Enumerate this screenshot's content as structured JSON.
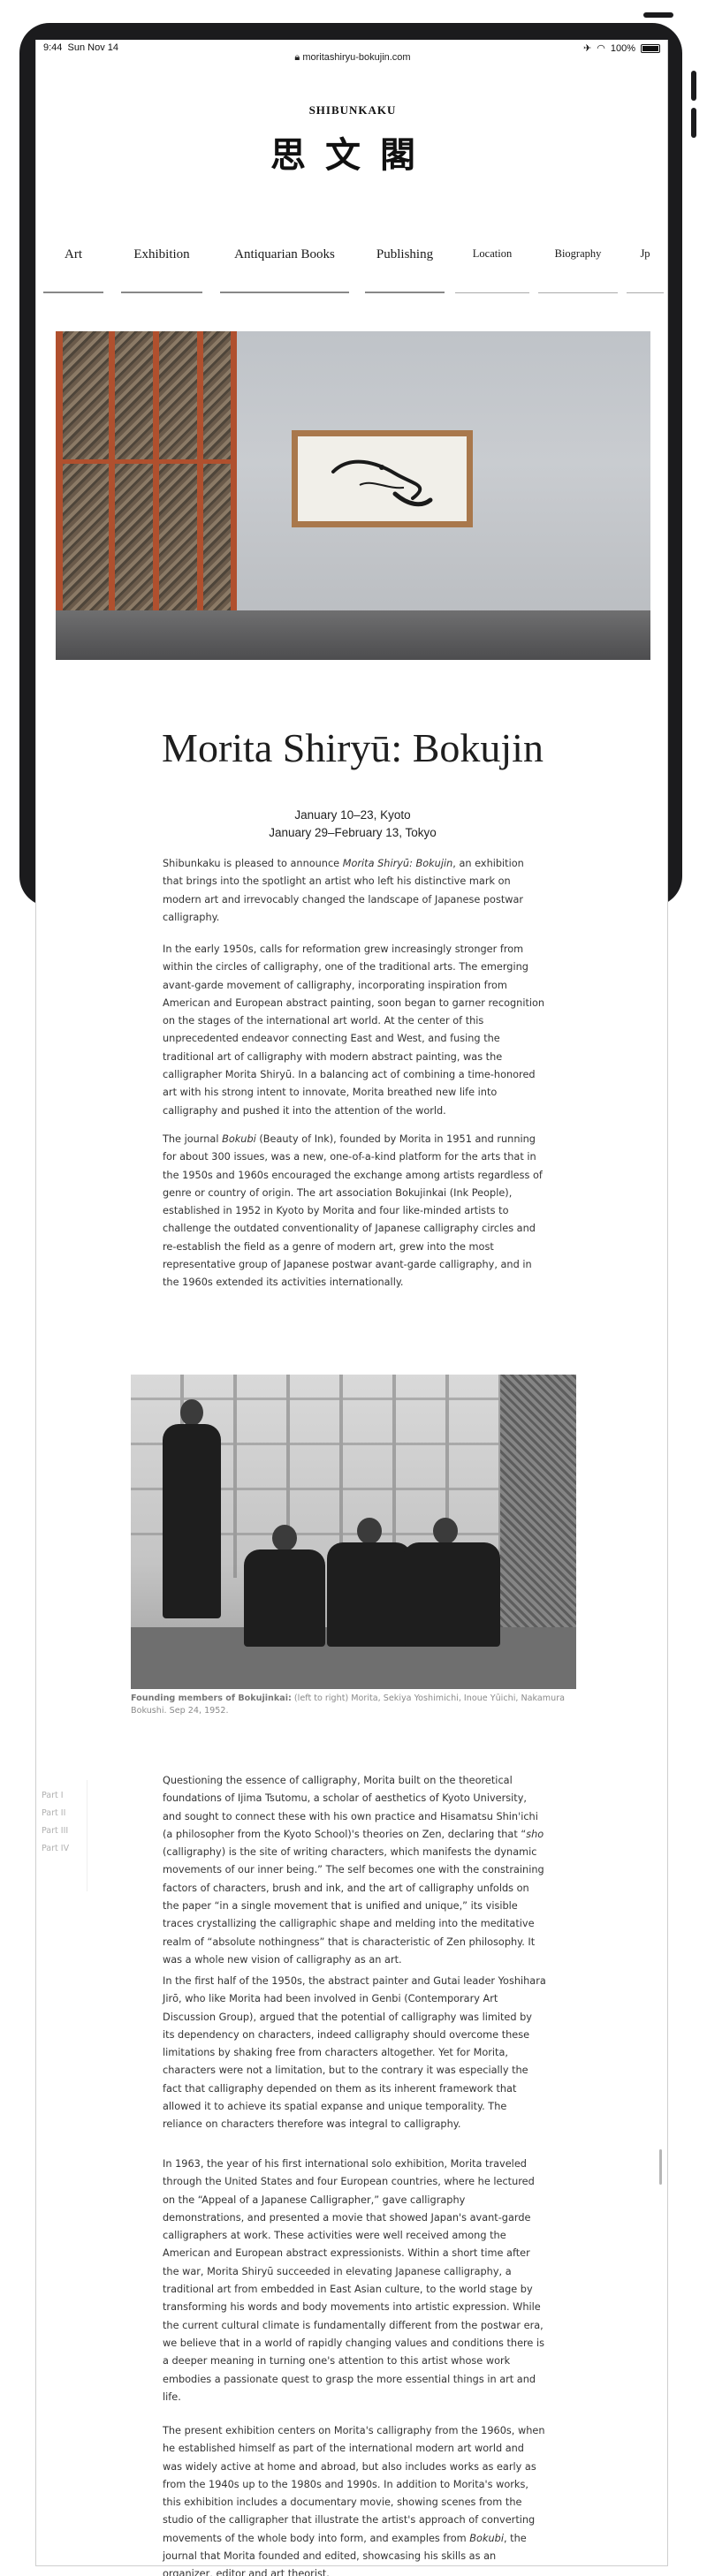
{
  "status_bar": {
    "time": "9:44",
    "date": "Sun Nov 14",
    "battery": "100%"
  },
  "url": "moritashiryu-bokujin.com",
  "brand": {
    "name": "SHIBUNKAKU",
    "logo_text": "思文閣"
  },
  "nav": [
    "Art",
    "Exhibition",
    "Antiquarian Books",
    "Publishing",
    "Location",
    "Biography",
    "Jp"
  ],
  "exhibition": {
    "title": "Morita Shiryū: Bokujin",
    "dates": [
      "January 10–23, Kyoto",
      "January 29–February 13, Tokyo"
    ]
  },
  "paragraphs": {
    "p1": [
      "Shibunkaku is pleased to announce ",
      "Morita Shiryū: Bokujin",
      ", an exhibition that brings into the spotlight an artist who left his distinctive mark on modern art and irrevocably changed the landscape of Japanese postwar calligraphy."
    ],
    "p2": "In the early 1950s, calls for reformation grew increasingly stronger from within the circles of calligraphy, one of the traditional arts. The emerging avant-garde movement of calligraphy, incorporating inspiration from American and European abstract painting, soon began to garner recognition on the stages of the international art world. At the center of this unprecedented endeavor connecting East and West, and fusing the traditional art of calligraphy with modern abstract painting, was the calligrapher Morita Shiryū. In a balancing act of combining a time-honored art with his strong intent to innovate, Morita breathed new life into calligraphy and pushed it into the attention of the world.",
    "p3": [
      "The journal ",
      "Bokubi",
      " (Beauty of Ink), founded by Morita in 1951 and running for about 300 issues, was a new, one-of-a-kind platform for the arts that in the 1950s and 1960s encouraged the exchange among artists regardless of genre or country of origin. The art association Bokujinkai (Ink People), established in 1952 in Kyoto by Morita and four like-minded artists to challenge the outdated conventionality of Japanese calligraphy circles and re-establish the field as a genre of modern art, grew into the most representative group of Japanese postwar avant-garde calligraphy, and in the 1960s extended its activities internationally."
    ],
    "p4": [
      "Questioning the essence of calligraphy, Morita built on the theoretical foundations of Ijima Tsutomu, a scholar of aesthetics of Kyoto University, and sought to connect these with his own practice and Hisamatsu Shin'ichi (a philosopher from the Kyoto School)'s theories on Zen, declaring that “",
      "sho",
      " (calligraphy) is the site of writing characters, which manifests the dynamic movements of our inner being.” The self becomes one with the constraining factors of characters, brush and ink, and the art of calligraphy unfolds on the paper “in a single movement that is unified and unique,” its visible traces crystallizing the calligraphic shape and melding into the meditative realm of “absolute nothingness” that is characteristic of Zen philosophy. It was a whole new vision of calligraphy as an art."
    ],
    "p5": "In the first half of the 1950s, the abstract painter and Gutai leader Yoshihara Jirō, who like Morita had been involved in Genbi (Contemporary Art Discussion Group), argued that the potential of calligraphy was limited by its dependency on characters, indeed calligraphy should overcome these limitations by shaking free from characters altogether. Yet for Morita, characters were not a limitation, but to the contrary it was especially the fact that calligraphy depended on them as its inherent framework that allowed it to achieve its spatial expanse and unique temporality. The reliance on characters therefore was integral to calligraphy.",
    "p6": "In 1963, the year of his first international solo exhibition, Morita traveled through the United States and four European countries, where he lectured on the “Appeal of a Japanese Calligrapher,” gave calligraphy demonstrations, and presented a movie that showed Japan's avant-garde calligraphers at work. These activities were well received among the American and European abstract expressionists. Within a short time after the war, Morita Shiryū succeeded in elevating Japanese calligraphy, a traditional art from embedded in East Asian culture, to the world stage by transforming his words and body movements into artistic expression. While the current cultural climate is fundamentally different from the postwar era, we believe that in a world of rapidly changing values and conditions there is a deeper meaning in turning one's attention to this artist whose work embodies a passionate quest to grasp the more essential things in art and life.",
    "p7": [
      "The present exhibition centers on Morita's calligraphy from the 1960s, when he established himself as part of the international modern art world and was widely active at home and abroad, but also includes works as early as from the 1940s up to the 1980s and 1990s. In addition to Morita's works, this exhibition includes a documentary movie, showing scenes from the studio of the calligrapher that illustrate the artist's approach of converting movements of the whole body into form, and examples from ",
      "Bokubi",
      ", the journal that Morita founded and edited, showcasing his skills as an organizer, editor and art theorist."
    ]
  },
  "photo_caption": {
    "label": "Founding members of Bokujinkai:",
    "text": " (left to right) Morita, Sekiya Yoshimichi, Inoue Yūichi, Nakamura Bokushi. Sep 24, 1952."
  },
  "parts_nav": [
    "Part I",
    "Part II",
    "Part III",
    "Part IV"
  ]
}
